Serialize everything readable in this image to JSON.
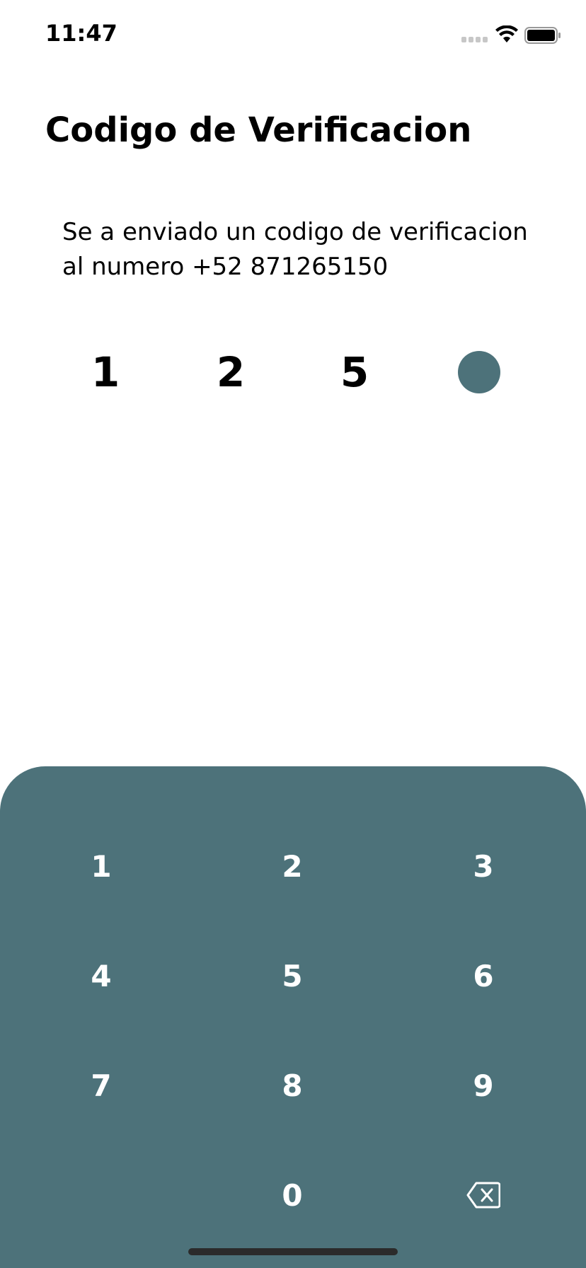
{
  "status_bar": {
    "time": "11:47"
  },
  "title": "Codigo de Verificacion",
  "message": {
    "line1": "Se a enviado un codigo de verificacion",
    "line2": "al numero  +52 871265150"
  },
  "code": {
    "digits": [
      "1",
      "2",
      "5"
    ],
    "placeholder_color": "#4d727a"
  },
  "keypad": {
    "background": "#4d727a",
    "keys": [
      "1",
      "2",
      "3",
      "4",
      "5",
      "6",
      "7",
      "8",
      "9",
      "0"
    ],
    "delete_icon": "backspace-icon"
  }
}
